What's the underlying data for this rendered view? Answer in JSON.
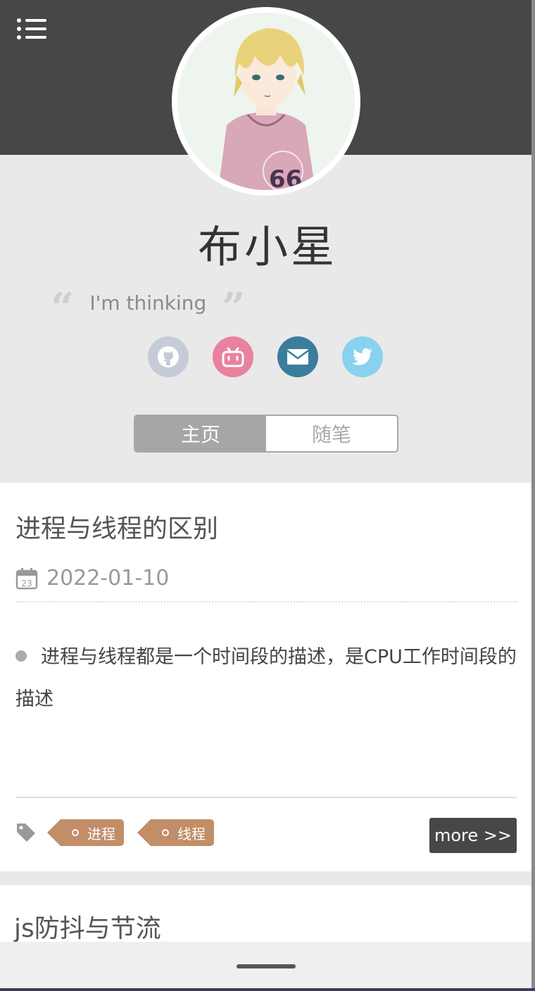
{
  "profile": {
    "name": "布小星",
    "quote": "I'm thinking",
    "quote_open": "“",
    "quote_close": "”"
  },
  "social": [
    {
      "icon": "github-icon",
      "color": "#c5ccd8"
    },
    {
      "icon": "bilibili-icon",
      "color": "#e9829f"
    },
    {
      "icon": "mail-icon",
      "color": "#3b7d9c"
    },
    {
      "icon": "twitter-icon",
      "color": "#88d2f0"
    }
  ],
  "tabs": [
    {
      "label": "主页",
      "active": true
    },
    {
      "label": "随笔",
      "active": false
    }
  ],
  "posts": [
    {
      "title": "进程与线程的区别",
      "date": "2022-01-10",
      "calendar_day": "23",
      "excerpt": "进程与线程都是一个时间段的描述，是CPU工作时间段的描述",
      "tags": [
        "进程",
        "线程"
      ],
      "more_label": "more >>"
    },
    {
      "title": "js防抖与节流"
    }
  ],
  "colors": {
    "header": "#474747",
    "tag": "#c18e68",
    "tab_active": "#a6a6a6"
  }
}
